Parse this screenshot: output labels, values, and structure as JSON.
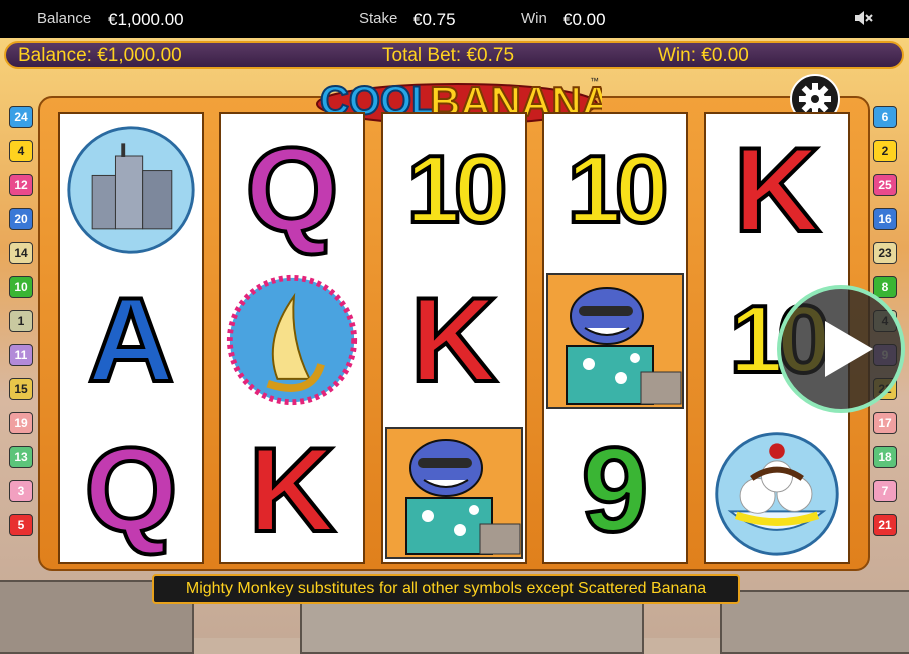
{
  "topbar": {
    "balance_label": "Balance",
    "balance_value": "€1,000.00",
    "stake_label": "Stake",
    "stake_value": "€0.75",
    "win_label": "Win",
    "win_value": "€0.00",
    "mute_icon": "speaker-mute-icon"
  },
  "infobar": {
    "balance": "Balance: €1,000.00",
    "total_bet": "Total Bet: €0.75",
    "win": "Win: €0.00"
  },
  "logo": {
    "text": "COOL BANANAS",
    "tm": "™"
  },
  "settings_icon": "gear-icon",
  "reels": [
    [
      "city",
      "A",
      "Q"
    ],
    [
      "Q",
      "banana",
      "K"
    ],
    [
      "10",
      "K",
      "monkey"
    ],
    [
      "10",
      "monkey",
      "9"
    ],
    [
      "K",
      "10",
      "sundae"
    ]
  ],
  "paylines_left": [
    "24",
    "4",
    "12",
    "20",
    "14",
    "10",
    "1",
    "11",
    "15",
    "19",
    "13",
    "3",
    "5"
  ],
  "paylines_right": [
    "6",
    "2",
    "25",
    "16",
    "23",
    "8",
    "4",
    "9",
    "22",
    "17",
    "18",
    "7",
    "21"
  ],
  "message": "Mighty Monkey substitutes for all other symbols except Scattered Banana",
  "play_icon": "play-icon",
  "colors": {
    "accent": "#ffd21f",
    "frame": "#f2a13a",
    "infobar": "#3a1f46"
  }
}
